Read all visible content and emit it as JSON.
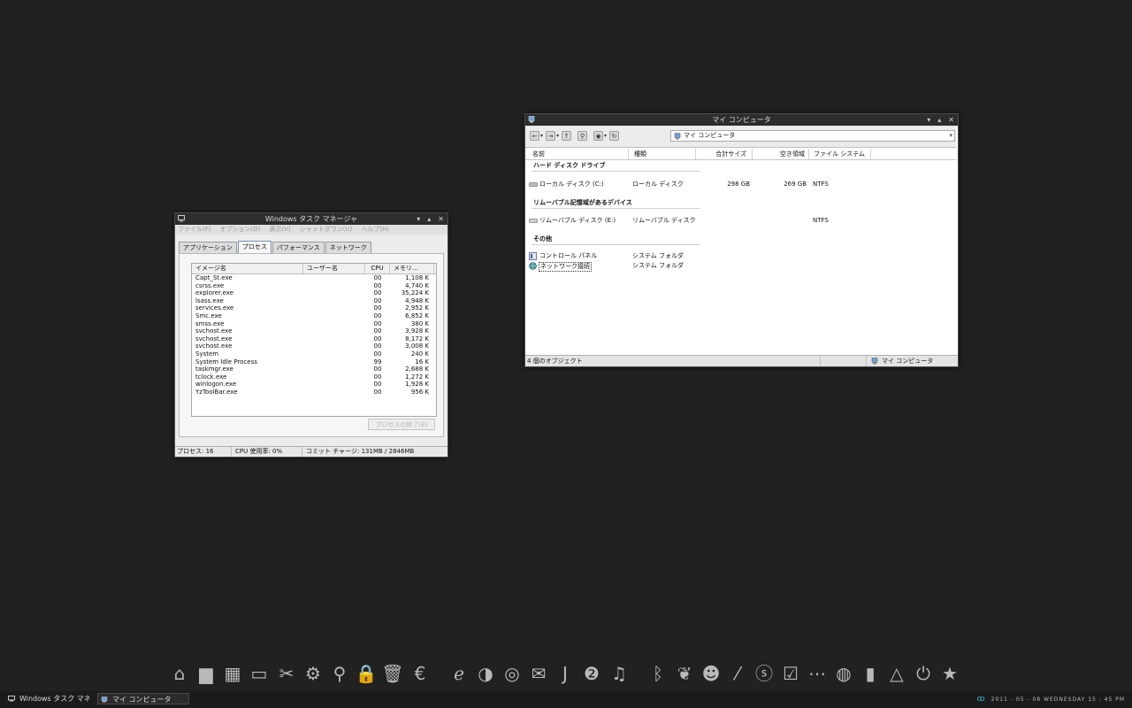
{
  "taskmgr": {
    "title": "Windows タスク マネージャ",
    "menu": [
      "ファイル(F)",
      "オプション(O)",
      "表示(V)",
      "シャットダウン(U)",
      "ヘルプ(H)"
    ],
    "tabs": [
      "アプリケーション",
      "プロセス",
      "パフォーマンス",
      "ネットワーク"
    ],
    "active_tab": "プロセス",
    "columns": [
      "イメージ名",
      "ユーザー名",
      "CPU",
      "メモリ..."
    ],
    "processes": [
      {
        "name": "Capt_St.exe",
        "user": "",
        "cpu": "00",
        "mem": "1,108 K"
      },
      {
        "name": "csrss.exe",
        "user": "",
        "cpu": "00",
        "mem": "4,740 K"
      },
      {
        "name": "explorer.exe",
        "user": "",
        "cpu": "00",
        "mem": "35,224 K"
      },
      {
        "name": "lsass.exe",
        "user": "",
        "cpu": "00",
        "mem": "4,948 K"
      },
      {
        "name": "services.exe",
        "user": "",
        "cpu": "00",
        "mem": "2,952 K"
      },
      {
        "name": "Smc.exe",
        "user": "",
        "cpu": "00",
        "mem": "6,852 K"
      },
      {
        "name": "smss.exe",
        "user": "",
        "cpu": "00",
        "mem": "380 K"
      },
      {
        "name": "svchost.exe",
        "user": "",
        "cpu": "00",
        "mem": "3,928 K"
      },
      {
        "name": "svchost.exe",
        "user": "",
        "cpu": "00",
        "mem": "8,172 K"
      },
      {
        "name": "svchost.exe",
        "user": "",
        "cpu": "00",
        "mem": "3,008 K"
      },
      {
        "name": "System",
        "user": "",
        "cpu": "00",
        "mem": "240 K"
      },
      {
        "name": "System Idle Process",
        "user": "",
        "cpu": "99",
        "mem": "16 K"
      },
      {
        "name": "taskmgr.exe",
        "user": "",
        "cpu": "00",
        "mem": "2,688 K"
      },
      {
        "name": "tclock.exe",
        "user": "",
        "cpu": "00",
        "mem": "1,272 K"
      },
      {
        "name": "winlogon.exe",
        "user": "",
        "cpu": "00",
        "mem": "1,928 K"
      },
      {
        "name": "YzToolBar.exe",
        "user": "",
        "cpu": "00",
        "mem": "956 K"
      }
    ],
    "end_process_button": "プロセスの終了(E)",
    "status": {
      "processes": "プロセス: 16",
      "cpu": "CPU 使用率: 0%",
      "commit": "コミット チャージ: 131MB / 2846MB"
    }
  },
  "explorer": {
    "title": "マイ コンピュータ",
    "address": "マイ コンピュータ",
    "columns": [
      "名前",
      "種類",
      "合計サイズ",
      "空き領域",
      "ファイル システム"
    ],
    "groups": [
      {
        "label": "ハード ディスク ドライブ",
        "items": [
          {
            "name": "ローカル ディスク (C:)",
            "type": "ローカル ディスク",
            "total": "298 GB",
            "free": "269 GB",
            "fs": "NTFS",
            "icon": "hard-drive-icon"
          }
        ]
      },
      {
        "label": "リムーバブル記憶域があるデバイス",
        "items": [
          {
            "name": "リムーバブル ディスク (E:)",
            "type": "リムーバブル ディスク",
            "total": "",
            "free": "",
            "fs": "NTFS",
            "icon": "removable-disk-icon"
          }
        ]
      },
      {
        "label": "その他",
        "items": [
          {
            "name": "コントロール パネル",
            "type": "システム フォルダ",
            "total": "",
            "free": "",
            "fs": "",
            "icon": "control-panel-icon"
          },
          {
            "name": "ネットワーク接続",
            "type": "システム フォルダ",
            "total": "",
            "free": "",
            "fs": "",
            "icon": "network-connections-icon"
          }
        ]
      }
    ],
    "status_left": "4 個のオブジェクト",
    "status_right": "マイ コンピュータ"
  },
  "dock": {
    "icons": [
      "home-icon",
      "folder-icon",
      "network-icon",
      "computer-icon",
      "tools-icon",
      "gear-icon",
      "search-icon",
      "lock-icon",
      "trash-icon",
      "media-player-icon",
      "internet-explorer-icon",
      "firefox-icon",
      "chrome-icon",
      "mail-icon",
      "j-icon",
      "two-circle-icon",
      "headphones-icon",
      "bluetooth-icon",
      "heart-pin-icon",
      "users-icon",
      "signal-icon",
      "skype-icon",
      "checkbox-icon",
      "world-map-icon",
      "mouse-icon",
      "battery-plug-icon",
      "triangle-icon",
      "power-icon",
      "star-icon"
    ],
    "glyphs": [
      "⌂",
      "▆",
      "▦",
      "▭",
      "✂",
      "⚙",
      "⚲",
      "🔒",
      "🗑",
      "€",
      "ℯ",
      "◑",
      "◎",
      "✉",
      "J",
      "❷",
      "♫",
      "ᛒ",
      "❦",
      "☻",
      "⁄",
      "ⓢ",
      "☑",
      "⋯",
      "◍",
      "▮",
      "△",
      "⏻",
      "★"
    ]
  },
  "taskbar": {
    "items": [
      "Windows タスク マネ...",
      "マイ コンピュータ"
    ],
    "clock": "2011 - 05 - 08 WEDNESDAY 15 : 45 PM"
  },
  "colors": {
    "desktop": "#212121",
    "titlebar": "#2d2d2d",
    "window": "#ececec",
    "dock_icon": "#b9b9b9"
  }
}
